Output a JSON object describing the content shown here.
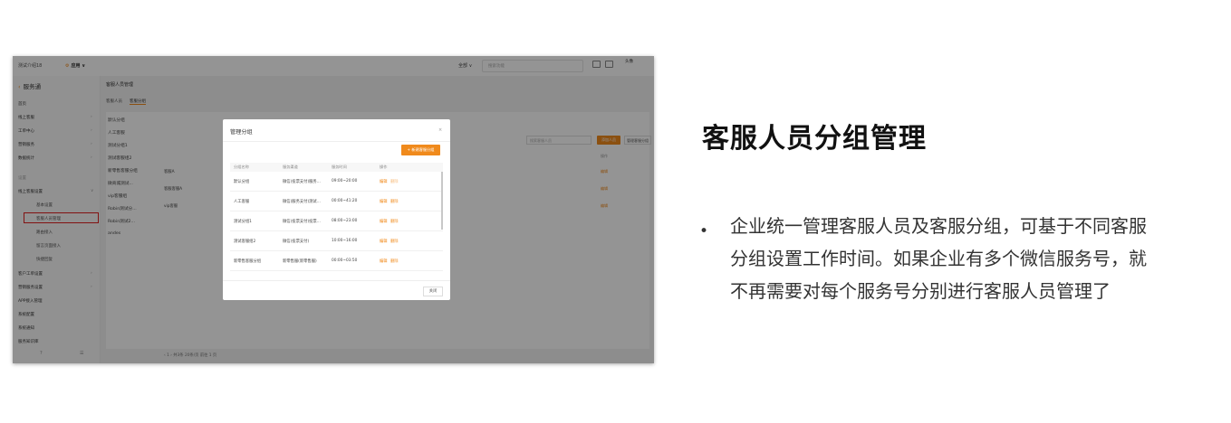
{
  "heading": "客服人员分组管理",
  "description_lines": [
    "企业统一管理客服人员及客服分组，可基于不同客服",
    "分组设置工作时间。如果企业有多个微信服务号，就",
    "不再需要对每个服务号分别进行客服人员管理了"
  ],
  "bullet": "•",
  "screenshot": {
    "topbar": {
      "org": "测试介绍18",
      "app": "应用",
      "app_icon": "gear-icon",
      "region_select": "全部 ∨",
      "search_placeholder": "搜索功能",
      "avatar": "头像"
    },
    "sidebar": {
      "brand": "服务通",
      "items": [
        "首页",
        "线上客服",
        "工单中心",
        "营销服务",
        "数据统计"
      ],
      "group_label": "设置",
      "settings_items": [
        "线上客服设置",
        "基本设置",
        "客服人员管理",
        "路由接入",
        "留言页面接入",
        "快捷回复",
        "客户工单设置",
        "营销服务设置",
        "APP接入管理",
        "系统配置",
        "系统通知",
        "服务知识库"
      ],
      "highlight_item": "客服人员管理",
      "footer_icons": [
        "help-icon",
        "menu-icon"
      ]
    },
    "main": {
      "header": "客服人员管理",
      "tabs": [
        "客服人员",
        "客服分组"
      ],
      "groups": [
        "默认分组",
        "人工客服",
        "测试分组1",
        "测试客服组2",
        "新零售客服分组",
        "微商城测试...",
        "vip客服组",
        "Robin测试分...",
        "Robin测试2...",
        "andes"
      ],
      "rows": [
        "客服A",
        "客服客服A",
        "vip客服"
      ],
      "search_placeholder": "搜索客服人员",
      "add_button": "添加人员",
      "manage_button": "管理客服分组",
      "col_op": "操作",
      "op_link": "编辑",
      "pager": "‹ 1 › 共3条 20条/页 前往 1 页",
      "floating_button": "企微"
    },
    "modal": {
      "title": "管理分组",
      "close": "×",
      "add_button": "+ 新建客服分组",
      "columns": [
        "分组名称",
        "服务渠道",
        "服务时间",
        "操作"
      ],
      "rows": [
        {
          "name": "默认分组",
          "channel": "微信(投票支付)服务...",
          "time": "09:00~20:00",
          "edit": "编辑",
          "del": "删除"
        },
        {
          "name": "人工客服",
          "channel": "微信(服务支付)测试...",
          "time": "00:00~41:20",
          "edit": "编辑",
          "del": "删除"
        },
        {
          "name": "测试分组1",
          "channel": "微信(投票支付)投票...",
          "time": "08:00~23:00",
          "edit": "编辑",
          "del": "删除"
        },
        {
          "name": "测试客服组2",
          "channel": "微信(投票支付)",
          "time": "10:00~16:00",
          "edit": "编辑",
          "del": "删除"
        },
        {
          "name": "新零售客服分组",
          "channel": "新零售服(新零售服)",
          "time": "00:00~03:50",
          "edit": "编辑",
          "del": "删除"
        }
      ],
      "footer_button": "关闭"
    }
  }
}
